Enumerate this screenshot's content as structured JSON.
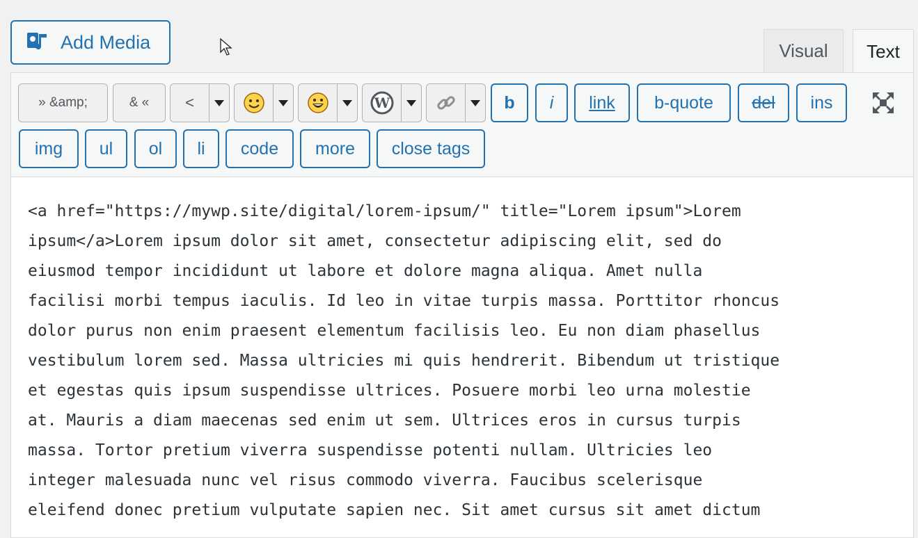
{
  "add_media": {
    "label": "Add Media",
    "icon": "media-icon"
  },
  "tabs": [
    {
      "label": "Visual",
      "active": false
    },
    {
      "label": "Text",
      "active": true
    }
  ],
  "toolbar": {
    "amp_left": "» &amp;",
    "amp_right": "& «",
    "lt": "<",
    "b": "b",
    "i": "i",
    "link": "link",
    "bquote": "b-quote",
    "del": "del",
    "ins": "ins",
    "img": "img",
    "ul": "ul",
    "ol": "ol",
    "li": "li",
    "code": "code",
    "more": "more",
    "close_tags": "close tags"
  },
  "content": {
    "lines": [
      "<a href=\"https://mywp.site/digital/lorem-ipsum/\" title=\"Lorem ipsum\">Lorem",
      "ipsum</a>Lorem ipsum dolor sit amet, consectetur adipiscing elit, sed do",
      "eiusmod tempor incididunt ut labore et dolore magna aliqua. Amet nulla",
      "facilisi morbi tempus iaculis. Id leo in vitae turpis massa. Porttitor rhoncus",
      "dolor purus non enim praesent elementum facilisis leo. Eu non diam phasellus",
      "vestibulum lorem sed. Massa ultricies mi quis hendrerit. Bibendum ut tristique",
      "et egestas quis ipsum suspendisse ultrices. Posuere morbi leo urna molestie",
      "at. Mauris a diam maecenas sed enim ut sem. Ultrices eros in cursus turpis",
      "massa. Tortor pretium viverra suspendisse potenti nullam. Ultricies leo",
      "integer malesuada nunc vel risus commodo viverra. Faucibus scelerisque",
      "eleifend donec pretium vulputate sapien nec. Sit amet cursus sit amet dictum"
    ]
  },
  "colors": {
    "accent": "#2271b1",
    "text": "#2c3338"
  }
}
